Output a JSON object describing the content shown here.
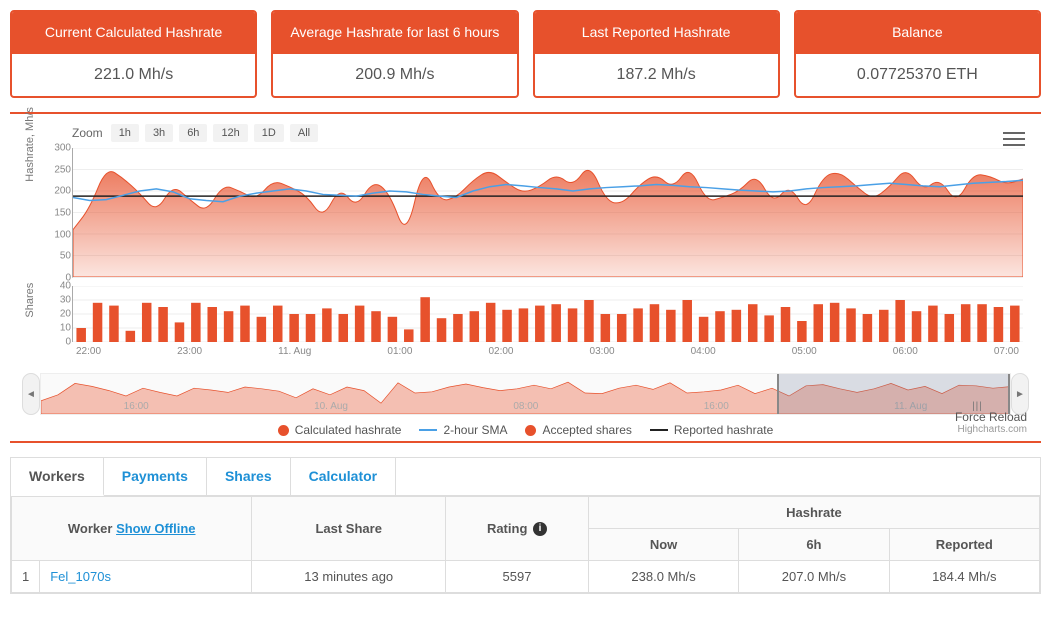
{
  "stats": [
    {
      "label": "Current Calculated Hashrate",
      "value": "221.0 Mh/s"
    },
    {
      "label": "Average Hashrate for last 6 hours",
      "value": "200.9 Mh/s"
    },
    {
      "label": "Last Reported Hashrate",
      "value": "187.2 Mh/s"
    },
    {
      "label": "Balance",
      "value": "0.07725370 ETH"
    }
  ],
  "zoom": {
    "label": "Zoom",
    "options": [
      "1h",
      "3h",
      "6h",
      "12h",
      "1D",
      "All"
    ]
  },
  "chart_data": {
    "type": "area+bar",
    "yaxis_label": "Hashrate, Mh/s",
    "yaxis2_label": "Shares",
    "yticks_hashrate": [
      0,
      50,
      100,
      150,
      200,
      250,
      300
    ],
    "yticks_shares": [
      0,
      10,
      20,
      30,
      40
    ],
    "xcategories": [
      "22:00",
      "23:00",
      "11. Aug",
      "01:00",
      "02:00",
      "03:00",
      "04:00",
      "05:00",
      "06:00",
      "07:00"
    ],
    "navigator_labels": [
      "16:00",
      "10. Aug",
      "08:00",
      "16:00",
      "11. Aug"
    ],
    "series": [
      {
        "name": "Calculated hashrate",
        "type": "area",
        "color": "#e7512c",
        "values": [
          110,
          160,
          255,
          230,
          195,
          150,
          215,
          180,
          150,
          215,
          200,
          180,
          225,
          210,
          190,
          135,
          210,
          160,
          225,
          195,
          90,
          260,
          175,
          185,
          225,
          250,
          220,
          195,
          210,
          240,
          210,
          265,
          175,
          170,
          215,
          240,
          205,
          260,
          175,
          185,
          200,
          240,
          170,
          215,
          150,
          235,
          245,
          210,
          180,
          210,
          255,
          200,
          230,
          170,
          240,
          235,
          215,
          228
        ]
      },
      {
        "name": "2-hour SMA",
        "type": "line",
        "color": "#4aa0e6",
        "values": [
          185,
          178,
          180,
          190,
          200,
          205,
          198,
          182,
          178,
          175,
          188,
          195,
          200,
          205,
          200,
          192,
          190,
          188,
          195,
          200,
          198,
          192,
          188,
          185,
          200,
          210,
          215,
          212,
          208,
          205,
          200,
          205,
          208,
          210,
          212,
          215,
          213,
          210,
          208,
          205,
          202,
          200,
          198,
          200,
          205,
          208,
          210,
          212,
          215,
          218,
          215,
          212,
          210,
          214,
          218,
          220,
          222,
          225
        ]
      },
      {
        "name": "Accepted shares",
        "type": "bar",
        "color": "#e7512c",
        "values": [
          10,
          28,
          26,
          8,
          28,
          25,
          14,
          28,
          25,
          22,
          26,
          18,
          26,
          20,
          20,
          24,
          20,
          26,
          22,
          18,
          9,
          32,
          17,
          20,
          22,
          28,
          23,
          24,
          26,
          27,
          24,
          30,
          20,
          20,
          24,
          27,
          23,
          30,
          18,
          22,
          23,
          27,
          19,
          25,
          15,
          27,
          28,
          24,
          20,
          23,
          30,
          22,
          26,
          20,
          27,
          27,
          25,
          26
        ]
      },
      {
        "name": "Reported hashrate",
        "type": "line",
        "color": "#222",
        "values": [
          188,
          188,
          188,
          188,
          188,
          188,
          188,
          188,
          188,
          188,
          188,
          188,
          188,
          188,
          188,
          188,
          188,
          188,
          188,
          188,
          188,
          188,
          188,
          188,
          188,
          188,
          188,
          188,
          188,
          188,
          188,
          188,
          188,
          188,
          188,
          188,
          188,
          188,
          188,
          188,
          188,
          188,
          188,
          188,
          188,
          188,
          188,
          188,
          188,
          188,
          188,
          188,
          188,
          188,
          188,
          188,
          188,
          188
        ]
      }
    ],
    "ylim_hashrate": [
      0,
      300
    ],
    "ylim_shares": [
      0,
      40
    ]
  },
  "legend": [
    {
      "label": "Calculated hashrate",
      "swatch": "dot",
      "color": "#e7512c"
    },
    {
      "label": "2-hour SMA",
      "swatch": "line",
      "color": "#4aa0e6"
    },
    {
      "label": "Accepted shares",
      "swatch": "dot",
      "color": "#e7512c"
    },
    {
      "label": "Reported hashrate",
      "swatch": "line",
      "color": "#222"
    }
  ],
  "force_reload": "Force Reload",
  "credits": "Highcharts.com",
  "tabs": [
    "Workers",
    "Payments",
    "Shares",
    "Calculator"
  ],
  "active_tab": 0,
  "workers_table": {
    "header_group": "Hashrate",
    "columns_left": {
      "worker": "Worker",
      "show_offline": "Show Offline",
      "last_share": "Last Share",
      "rating": "Rating"
    },
    "columns_hash": [
      "Now",
      "6h",
      "Reported"
    ],
    "rows": [
      {
        "idx": "1",
        "name": "Fel_1070s",
        "last_share": "13 minutes ago",
        "rating": "5597",
        "now": "238.0 Mh/s",
        "h6": "207.0 Mh/s",
        "reported": "184.4 Mh/s"
      }
    ]
  },
  "colors": {
    "accent": "#e7512c",
    "link": "#1e90d6"
  }
}
